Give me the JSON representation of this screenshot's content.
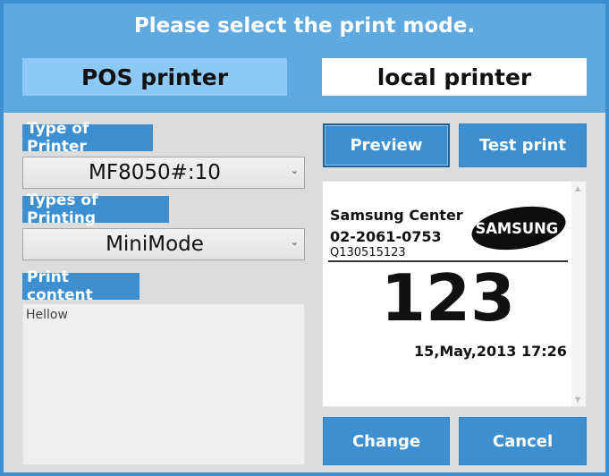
{
  "header": {
    "title": "Please select the print mode.",
    "tabs": [
      {
        "label": "POS printer",
        "active": true
      },
      {
        "label": "local printer",
        "active": false
      }
    ]
  },
  "left": {
    "type_label": "Type of Printer",
    "type_value": "MF8050#:10",
    "printing_label": "Types of Printing",
    "printing_value": "MiniMode",
    "content_label": "Print content",
    "content_value": "Hellow"
  },
  "buttons": {
    "preview": "Preview",
    "test_print": "Test print",
    "change": "Change",
    "cancel": "Cancel"
  },
  "preview": {
    "center_name": "Samsung Center",
    "phone": "02-2061-0753",
    "code": "Q130515123",
    "logo_text": "SAMSUNG",
    "number": "123",
    "date": "15,May,2013",
    "time": "17:26"
  },
  "icons": {
    "dropdown": "chevron-down-icon",
    "scroll_up": "scroll-up-icon",
    "scroll_down": "scroll-down-icon"
  },
  "colors": {
    "header": "#5ea9df",
    "accent": "#3e8fd0",
    "active_tab": "#8ec9f5",
    "panel": "#dcdcdc"
  }
}
